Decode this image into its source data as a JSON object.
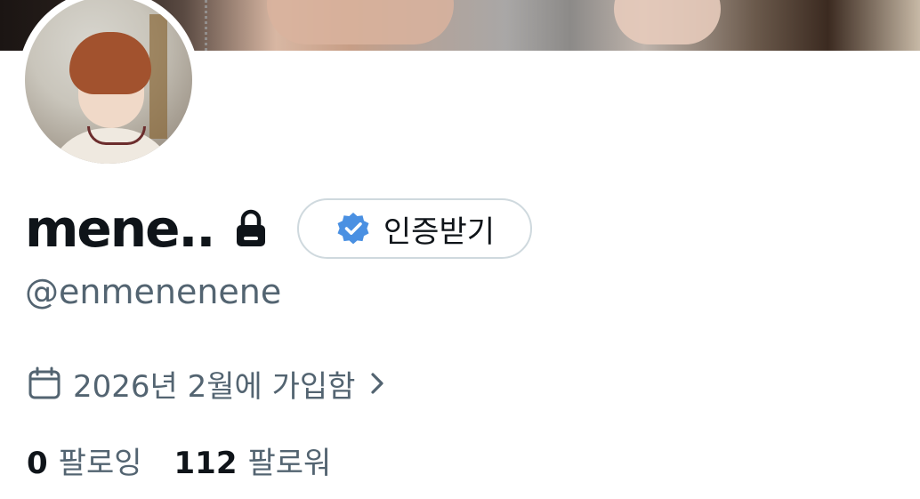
{
  "profile": {
    "display_name": "mene..",
    "handle": "@enmenenene",
    "verify_button_label": "인증받기",
    "joined_text": "2026년 2월에 가입함",
    "following_count": "0",
    "following_label": "팔로잉",
    "followers_count": "112",
    "followers_label": "팔로워"
  },
  "icons": {
    "lock": "lock-icon",
    "verified_badge": "verified-badge-icon",
    "calendar": "calendar-icon",
    "chevron": "chevron-right-icon"
  },
  "colors": {
    "text_primary": "#0f1419",
    "text_secondary": "#536471",
    "verified_blue": "#4a90e2",
    "button_border": "#cfd9de"
  }
}
